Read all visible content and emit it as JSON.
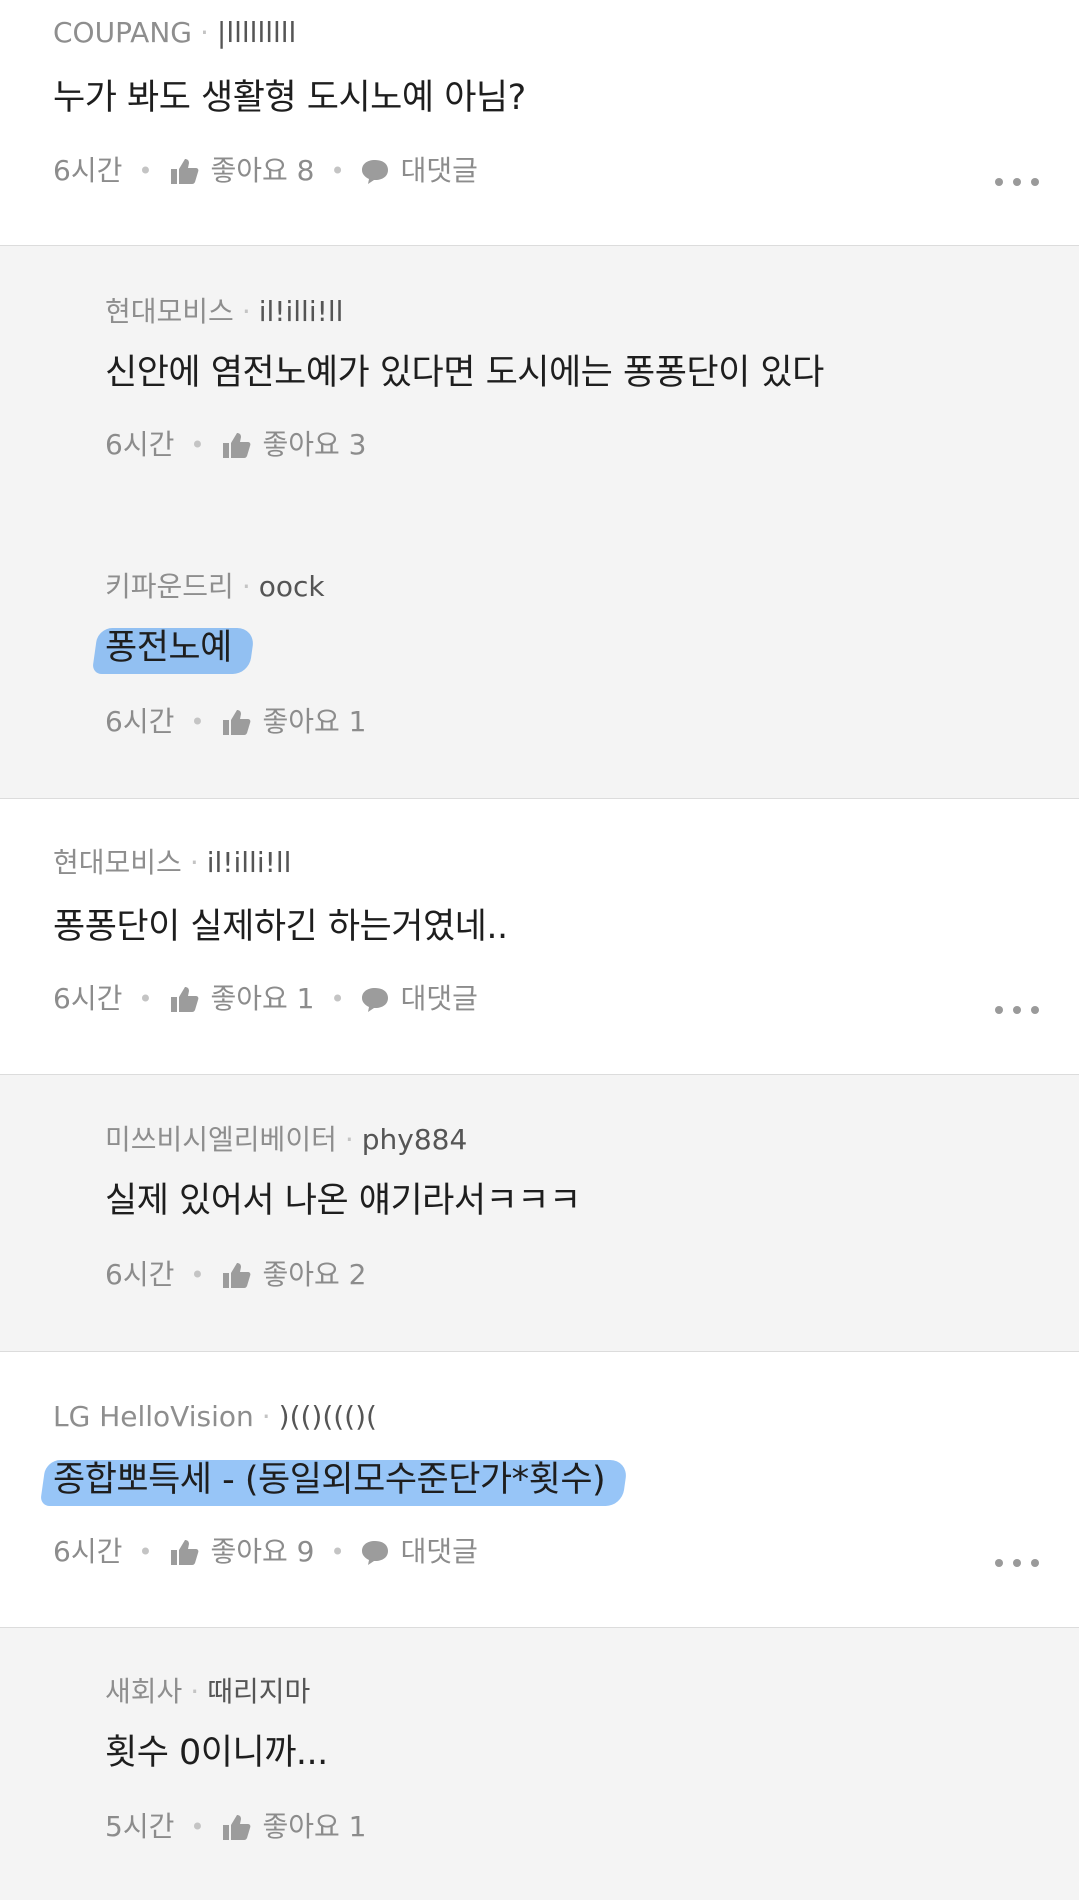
{
  "comments": [
    {
      "company": "COUPANG",
      "nick": "|lllllllll",
      "text": "누가 봐도 생활형 도시노예 아님?",
      "time": "6시간",
      "likes": "좋아요 8",
      "reply": "대댓글"
    },
    {
      "company": "현대모비스",
      "nick": "il!illi!ll",
      "text": "신안에 염전노예가 있다면 도시에는 퐁퐁단이 있다",
      "time": "6시간",
      "likes": "좋아요 3"
    },
    {
      "company": "키파운드리",
      "nick": "oock",
      "text": "퐁전노예",
      "time": "6시간",
      "likes": "좋아요 1"
    },
    {
      "company": "현대모비스",
      "nick": "il!illi!ll",
      "text": "퐁퐁단이 실제하긴 하는거였네..",
      "time": "6시간",
      "likes": "좋아요 1",
      "reply": "대댓글"
    },
    {
      "company": "미쓰비시엘리베이터",
      "nick": "phy884",
      "text": "실제 있어서 나온 얘기라서ㅋㅋㅋ",
      "time": "6시간",
      "likes": "좋아요 2"
    },
    {
      "company": "LG HelloVision",
      "nick": ")(()((()(",
      "text": "종합뽀득세 - (동일외모수준단가*횟수)",
      "time": "6시간",
      "likes": "좋아요 9",
      "reply": "대댓글"
    },
    {
      "company": "새회사",
      "nick": "때리지마",
      "text": "횟수 0이니까...",
      "time": "5시간",
      "likes": "좋아요 1"
    }
  ],
  "colors": {
    "highlight": "#4296f0",
    "reply_bg": "#f4f4f4"
  }
}
